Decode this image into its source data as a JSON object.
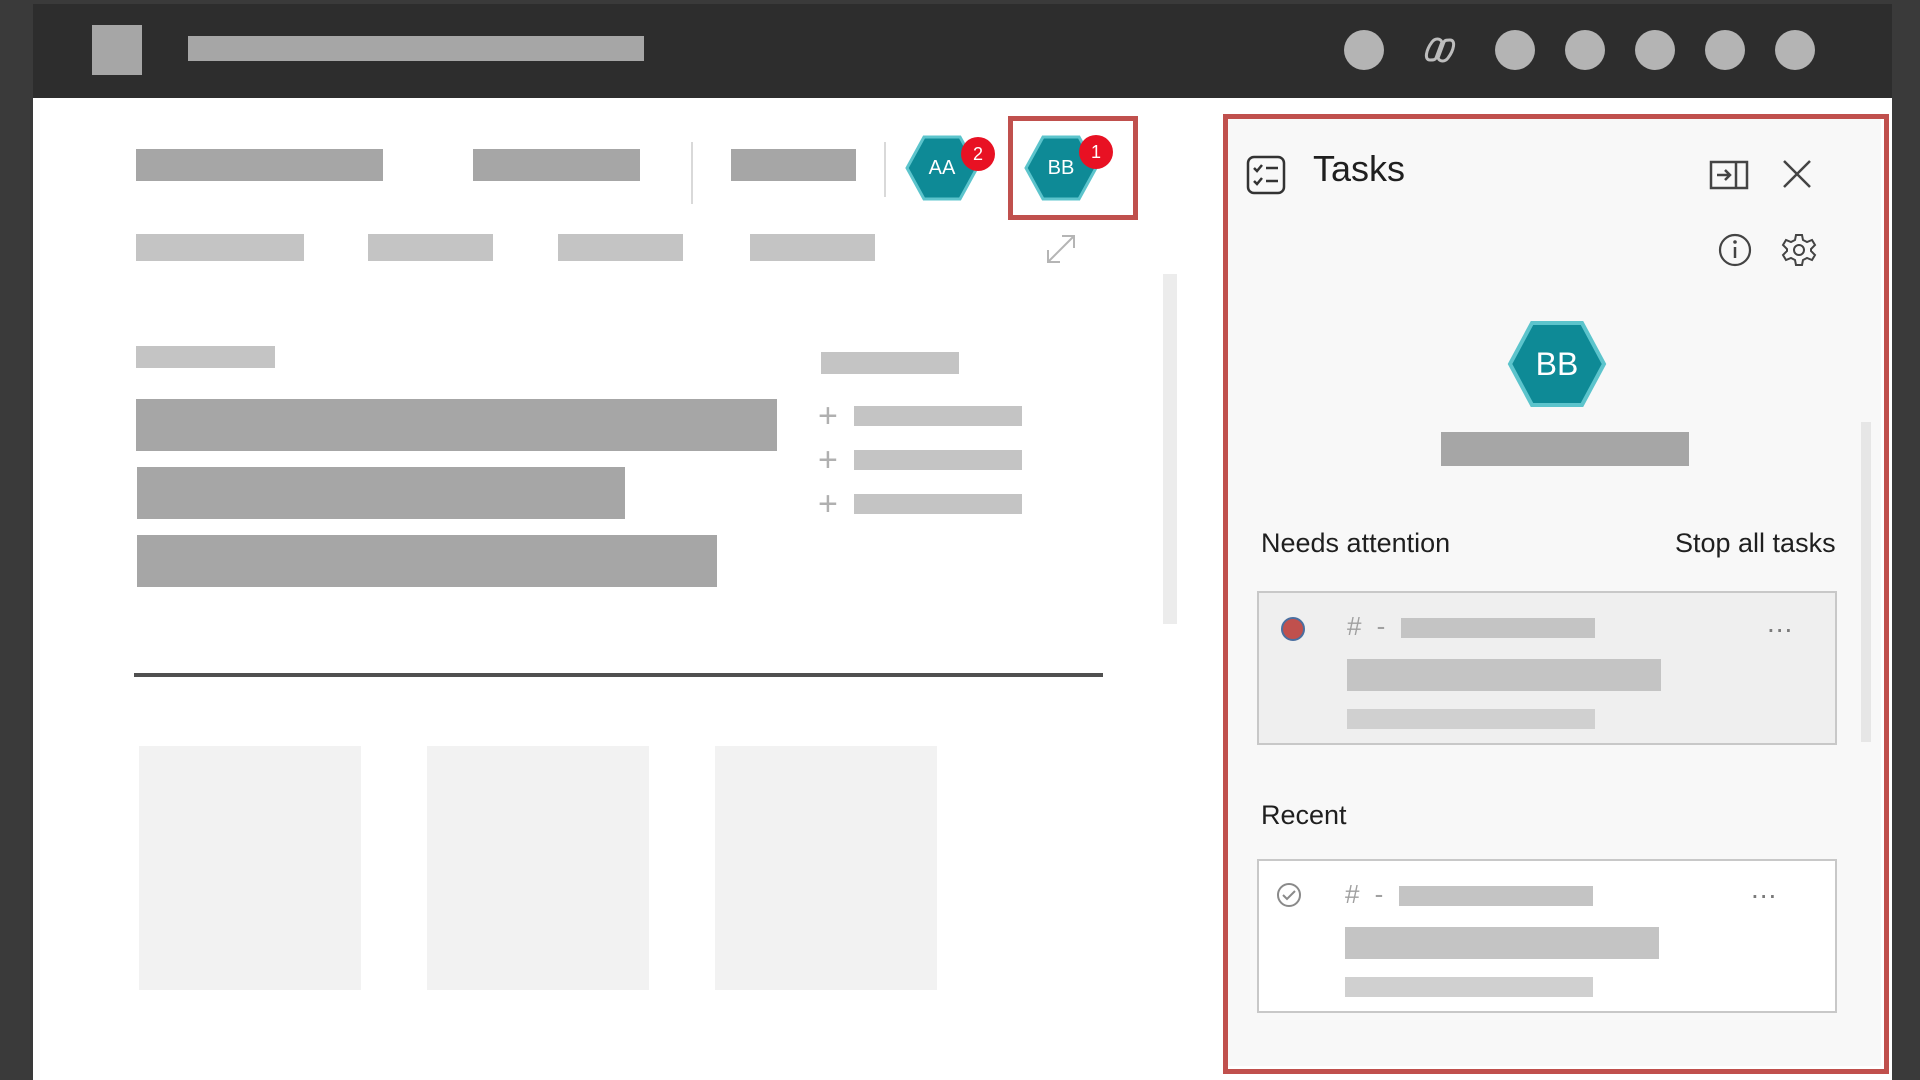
{
  "panel": {
    "title": "Tasks",
    "avatar_initials": "BB",
    "needs_attention_label": "Needs attention",
    "stop_all_label": "Stop all tasks",
    "recent_label": "Recent",
    "attention_task": {
      "prefix": "# -"
    },
    "recent_task": {
      "prefix": "# -"
    },
    "more_label": "...",
    "icons": [
      "tasks-icon",
      "dock-icon",
      "close-icon",
      "info-icon",
      "gear-icon"
    ]
  },
  "toolbar": {
    "avatars": [
      {
        "initials": "AA",
        "badge": "2"
      },
      {
        "initials": "BB",
        "badge": "1"
      }
    ]
  },
  "colors": {
    "avatar_teal": "#0e8a96",
    "badge_red": "#e81123",
    "highlight": "#c0504d",
    "titlebar": "#2d2d2d"
  }
}
